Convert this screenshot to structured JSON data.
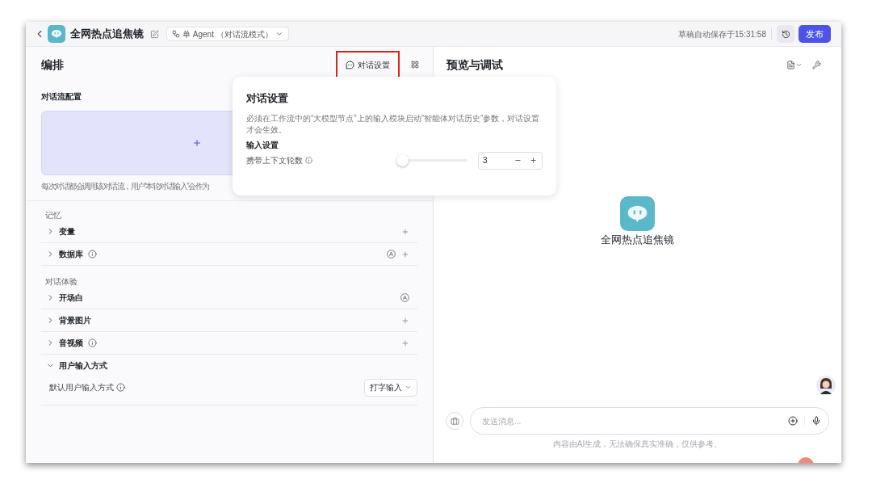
{
  "top_bar": {
    "title": "全网热点追焦镜",
    "mode": "单 Agent （对话流模式）",
    "autosave": "草稿自动保存于15:31:58",
    "publish": "发布"
  },
  "editor": {
    "title": "编排",
    "settings_button": {
      "label": "对话设置",
      "highlighted": true
    },
    "flow_config": {
      "title": "对话流配置",
      "note": "每次对话都会调用该对话流，用户“本轮对话输入”会作为"
    },
    "sections": [
      {
        "title": "记忆",
        "rows": [
          {
            "label": "变量",
            "expanded": false,
            "info": false,
            "auto": false,
            "add": true
          },
          {
            "label": "数据库",
            "expanded": false,
            "info": true,
            "auto": true,
            "add": true
          }
        ]
      },
      {
        "title": "对话体验",
        "rows": [
          {
            "label": "开场白",
            "expanded": false,
            "info": false,
            "auto": true,
            "add": false
          },
          {
            "label": "背景图片",
            "expanded": false,
            "info": false,
            "auto": false,
            "add": true
          },
          {
            "label": "音视频",
            "expanded": false,
            "info": true,
            "auto": false,
            "add": true
          },
          {
            "label": "用户输入方式",
            "expanded": true,
            "info": false,
            "auto": false,
            "add": false,
            "setting": {
              "label": "默认用户输入方式",
              "value": "打字输入"
            }
          }
        ]
      }
    ]
  },
  "preview": {
    "title": "预览与调试",
    "bot_name": "全网热点追焦镜",
    "placeholder": "发送消息...",
    "disclaimer": "内容由AI生成，无法确保真实准确，仅供参考。"
  },
  "dialog": {
    "title": "对话设置",
    "description": "必须在工作流中的“大模型节点”上的输入模块启动“智能体对话历史”参数，对话设置才会生效。",
    "section": "输入设置",
    "slider": {
      "label": "携带上下文轮数",
      "level": 0,
      "value": "3"
    }
  }
}
